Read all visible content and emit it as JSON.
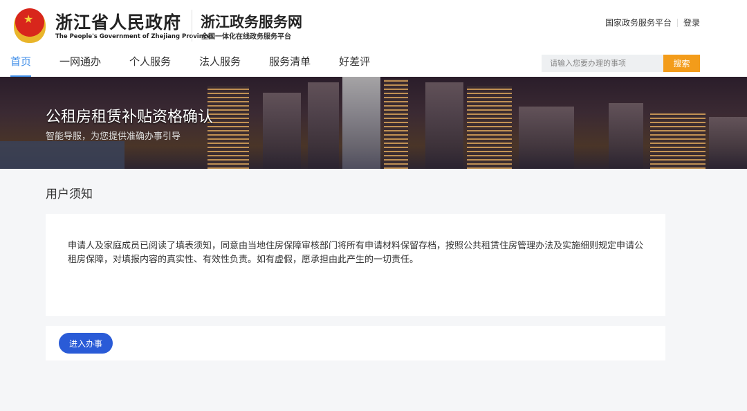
{
  "header": {
    "gov_title": "浙江省人民政府",
    "gov_title_en": "The People's Government of Zhejiang Province",
    "site_title": "浙江政务服务网",
    "site_subtitle": "全国一体化在线政务服务平台",
    "top_links": [
      "国家政务服务平台",
      "登录"
    ]
  },
  "nav": {
    "items": [
      "首页",
      "一网通办",
      "个人服务",
      "法人服务",
      "服务清单",
      "好差评"
    ],
    "active": "首页"
  },
  "search": {
    "placeholder": "请输入您要办理的事项",
    "button": "搜索"
  },
  "banner": {
    "title": "公租房租赁补贴资格确认",
    "subtitle": "智能导服，为您提供准确办事引导"
  },
  "notice": {
    "title": "用户须知",
    "text": "申请人及家庭成员已阅读了填表须知，同意由当地住房保障审核部门将所有申请材料保留存档，按照公共租赁住房管理办法及实施细则规定申请公租房保障，对填报内容的真实性、有效性负责。如有虚假，愿承担由此产生的一切责任。"
  },
  "actions": {
    "enter_button": "进入办事"
  },
  "colors": {
    "accent": "#3f8ee8",
    "search_button": "#f39c1a",
    "primary_button": "#2a5bd7"
  }
}
